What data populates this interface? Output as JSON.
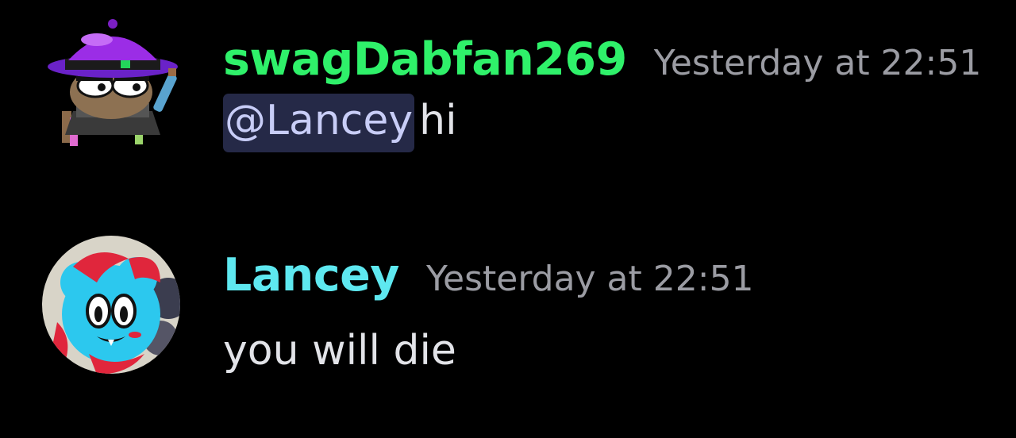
{
  "messages": [
    {
      "username": "swagDabfan269",
      "username_color": "#2ff16a",
      "timestamp": "Yesterday at 22:51",
      "mention": "@Lancey",
      "text": "hi"
    },
    {
      "username": "Lancey",
      "username_color": "#5ee8f0",
      "timestamp": "Yesterday at 22:51",
      "text": "you will die"
    }
  ],
  "colors": {
    "background": "#000000",
    "timestamp": "#9b9ca3",
    "message_text": "#e2e3e8",
    "mention_bg": "#252947",
    "mention_text": "#c8cdf7"
  }
}
